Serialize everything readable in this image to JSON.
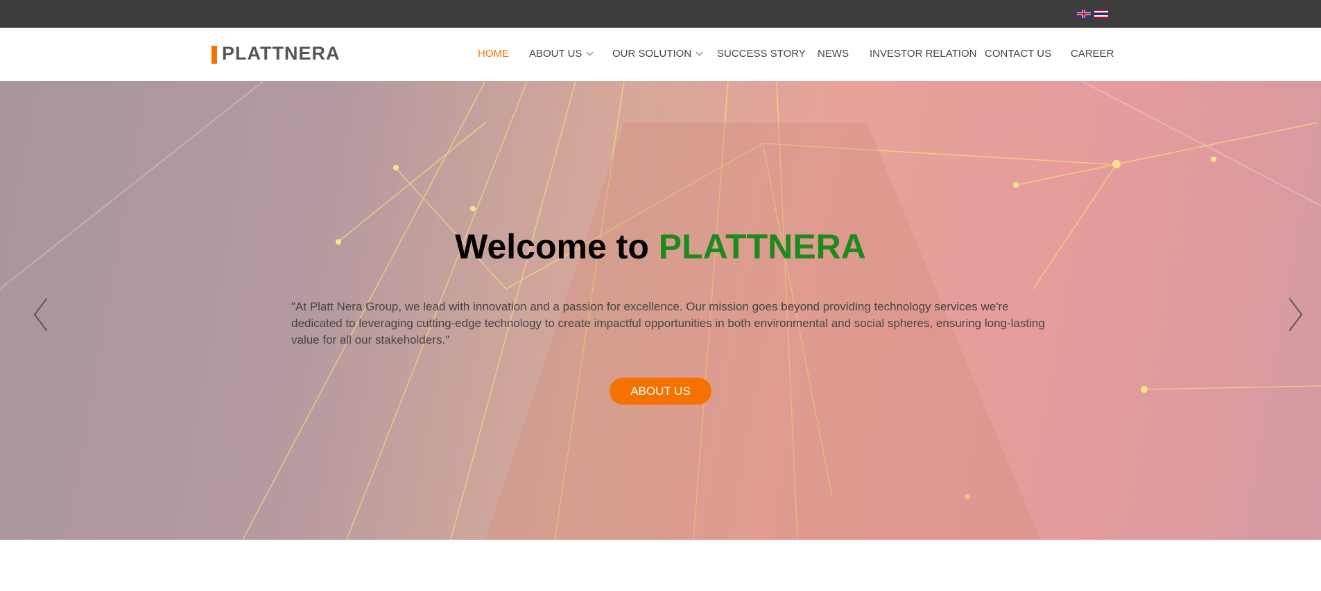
{
  "topbar": {
    "languages": [
      {
        "code": "en",
        "icon": "uk-flag-icon"
      },
      {
        "code": "th",
        "icon": "thai-flag-icon"
      }
    ]
  },
  "header": {
    "logo": "PLATTNERA",
    "nav": [
      {
        "label": "HOME",
        "active": true
      },
      {
        "label": "ABOUT US",
        "dropdown": true
      },
      {
        "label": "OUR SOLUTION",
        "dropdown": true
      },
      {
        "label": "SUCCESS STORY"
      },
      {
        "label": "NEWS"
      },
      {
        "label": "INVESTOR RELATION"
      },
      {
        "label": "CONTACT US"
      },
      {
        "label": "CAREER"
      }
    ]
  },
  "hero": {
    "title_prefix": "Welcome to",
    "title_brand": "PLATTNERA",
    "text": "\"At Platt Nera Group, we lead with innovation and a passion for excellence. Our mission goes beyond providing technology services we're dedicated to leveraging cutting-edge technology to create impactful opportunities in both environmental and social spheres, ensuring long-lasting value for all our stakeholders.\"",
    "button": "ABOUT US"
  },
  "colors": {
    "accent": "#f57200",
    "brand_green": "#1e8a1e",
    "topbar": "#3d3d3d"
  }
}
